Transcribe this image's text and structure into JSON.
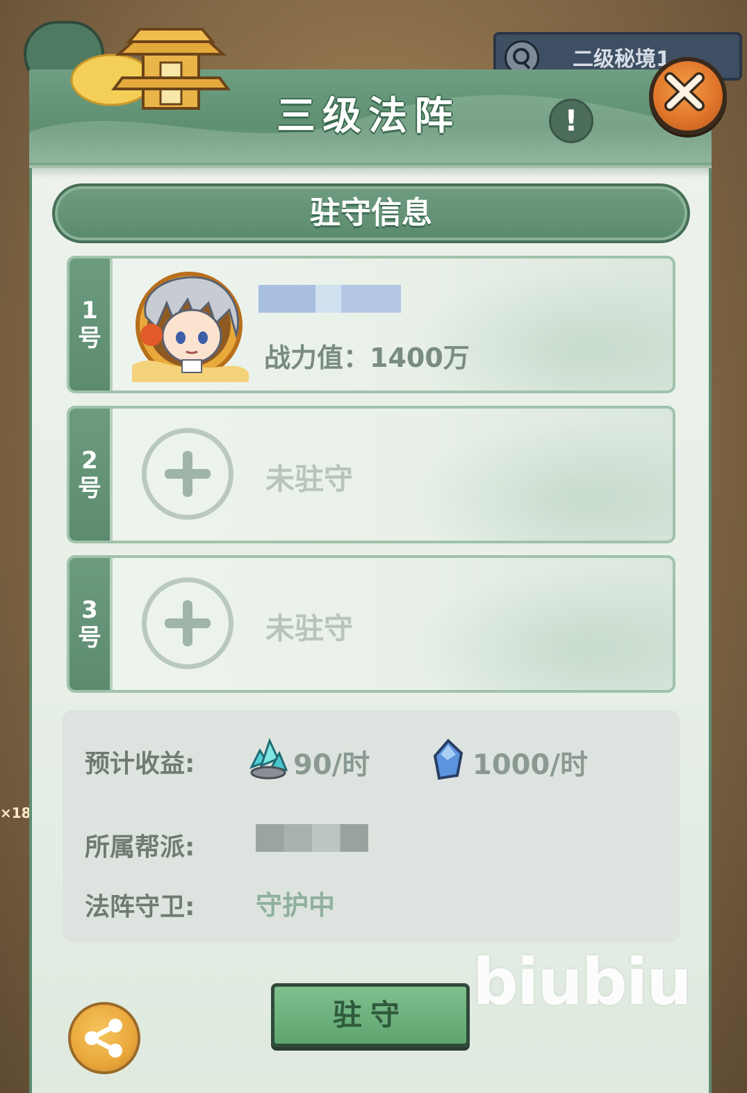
{
  "background": {
    "search_text": "二级秘境1",
    "left_text": "×18"
  },
  "dialog": {
    "title": "三级法阵",
    "info_symbol": "!",
    "section_title": "驻守信息"
  },
  "slots": [
    {
      "number_digit": "1",
      "number_suffix": "号",
      "occupied": true,
      "power_label": "战力值：",
      "power_value": "1400万",
      "name_hidden": true
    },
    {
      "number_digit": "2",
      "number_suffix": "号",
      "occupied": false,
      "empty_label": "未驻守"
    },
    {
      "number_digit": "3",
      "number_suffix": "号",
      "occupied": false,
      "empty_label": "未驻守"
    }
  ],
  "info": {
    "income_label": "预计收益:",
    "income": [
      {
        "icon": "cyan-crystal-icon",
        "value": "90/时"
      },
      {
        "icon": "blue-gem-icon",
        "value": "1000/时"
      }
    ],
    "gang_label": "所属帮派:",
    "gang_value_hidden": true,
    "guard_label": "法阵守卫:",
    "guard_status": "守护中"
  },
  "actions": {
    "defend_label": "驻守",
    "share_icon": "share-icon"
  },
  "watermark": "biubiu",
  "colors": {
    "header_green": "#5f8f72",
    "panel_bg": "#eef3ec",
    "close_orange": "#e0762a",
    "share_gold": "#e9a73b",
    "button_green": "#6fb07f"
  }
}
